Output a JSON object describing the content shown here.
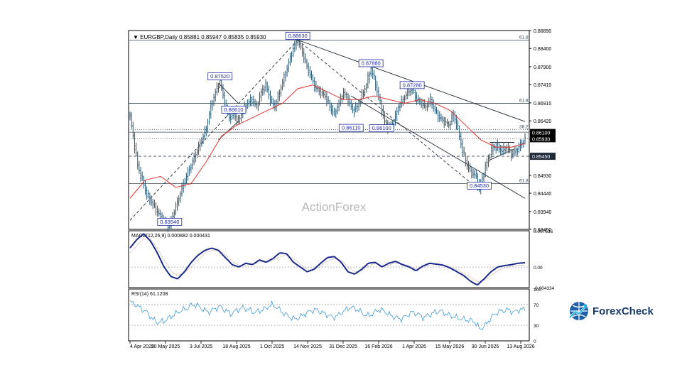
{
  "chart_data": [
    {
      "type": "candlestick",
      "header": {
        "symbol": "EURGBP,Daily",
        "values": "0.85881 0.85947 0.85835 0.85930"
      },
      "watermark": "ActionForex",
      "ylim": [
        0.8345,
        0.8889
      ],
      "y_ticks": [
        "0.88890",
        "0.88400",
        "0.87900",
        "0.87410",
        "0.86910",
        "0.86420",
        "0.85930",
        "0.85450",
        "0.84930",
        "0.84440",
        "0.83940",
        "0.83450"
      ],
      "x_ticks": [
        "4 Apr 2025",
        "20 May 2025",
        "3 Jul 2025",
        "18 Aug 2025",
        "1 Oct 2025",
        "14 Nov 2025",
        "31 Dec 2025",
        "16 Feb 2026",
        "1 Apr 2026",
        "15 May 2026",
        "30 Jun 2026",
        "13 Aug 2026"
      ],
      "price_path": [
        [
          0,
          0.8655
        ],
        [
          2,
          0.86
        ],
        [
          5,
          0.852
        ],
        [
          8,
          0.848
        ],
        [
          11,
          0.844
        ],
        [
          14,
          0.842
        ],
        [
          17,
          0.84
        ],
        [
          20,
          0.838
        ],
        [
          23,
          0.8365
        ],
        [
          26,
          0.8354
        ],
        [
          29,
          0.8395
        ],
        [
          32,
          0.843
        ],
        [
          35,
          0.847
        ],
        [
          38,
          0.85
        ],
        [
          41,
          0.853
        ],
        [
          44,
          0.856
        ],
        [
          47,
          0.859
        ],
        [
          50,
          0.862
        ],
        [
          53,
          0.868
        ],
        [
          56,
          0.872
        ],
        [
          59,
          0.8752
        ],
        [
          62,
          0.869
        ],
        [
          65,
          0.865
        ],
        [
          68,
          0.8661
        ],
        [
          71,
          0.864
        ],
        [
          74,
          0.867
        ],
        [
          77,
          0.869
        ],
        [
          80,
          0.87
        ],
        [
          83,
          0.868
        ],
        [
          86,
          0.872
        ],
        [
          89,
          0.874
        ],
        [
          92,
          0.87
        ],
        [
          95,
          0.868
        ],
        [
          98,
          0.872
        ],
        [
          101,
          0.876
        ],
        [
          104,
          0.88
        ],
        [
          107,
          0.884
        ],
        [
          110,
          0.8863
        ],
        [
          113,
          0.883
        ],
        [
          116,
          0.879
        ],
        [
          119,
          0.876
        ],
        [
          122,
          0.873
        ],
        [
          125,
          0.872
        ],
        [
          128,
          0.871
        ],
        [
          131,
          0.868
        ],
        [
          134,
          0.866
        ],
        [
          137,
          0.869
        ],
        [
          140,
          0.872
        ],
        [
          143,
          0.87
        ],
        [
          146,
          0.867
        ],
        [
          149,
          0.868
        ],
        [
          152,
          0.871
        ],
        [
          155,
          0.874
        ],
        [
          158,
          0.8788
        ],
        [
          161,
          0.874
        ],
        [
          164,
          0.869
        ],
        [
          167,
          0.864
        ],
        [
          170,
          0.862
        ],
        [
          173,
          0.864
        ],
        [
          176,
          0.868
        ],
        [
          179,
          0.87
        ],
        [
          182,
          0.872
        ],
        [
          185,
          0.8728
        ],
        [
          188,
          0.87
        ],
        [
          191,
          0.869
        ],
        [
          194,
          0.868
        ],
        [
          197,
          0.87
        ],
        [
          200,
          0.867
        ],
        [
          203,
          0.865
        ],
        [
          206,
          0.864
        ],
        [
          209,
          0.863
        ],
        [
          212,
          0.866
        ],
        [
          215,
          0.862
        ],
        [
          218,
          0.856
        ],
        [
          221,
          0.852
        ],
        [
          224,
          0.85
        ],
        [
          227,
          0.849
        ],
        [
          229,
          0.8453
        ],
        [
          232,
          0.85
        ],
        [
          235,
          0.854
        ],
        [
          238,
          0.857
        ],
        [
          241,
          0.857
        ],
        [
          244,
          0.856
        ],
        [
          247,
          0.857
        ],
        [
          250,
          0.855
        ],
        [
          253,
          0.856
        ],
        [
          256,
          0.8575
        ],
        [
          259,
          0.8593
        ]
      ],
      "ma_path": [
        [
          0,
          0.843
        ],
        [
          10,
          0.848
        ],
        [
          20,
          0.849
        ],
        [
          30,
          0.846
        ],
        [
          40,
          0.847
        ],
        [
          50,
          0.853
        ],
        [
          60,
          0.86
        ],
        [
          70,
          0.863
        ],
        [
          80,
          0.865
        ],
        [
          90,
          0.867
        ],
        [
          100,
          0.869
        ],
        [
          110,
          0.873
        ],
        [
          120,
          0.874
        ],
        [
          130,
          0.872
        ],
        [
          140,
          0.87
        ],
        [
          150,
          0.87
        ],
        [
          160,
          0.871
        ],
        [
          170,
          0.87
        ],
        [
          180,
          0.869
        ],
        [
          190,
          0.87
        ],
        [
          200,
          0.869
        ],
        [
          210,
          0.867
        ],
        [
          220,
          0.863
        ],
        [
          230,
          0.859
        ],
        [
          240,
          0.857
        ],
        [
          250,
          0.857
        ],
        [
          259,
          0.858
        ]
      ],
      "trendlines": [
        {
          "x1": 0,
          "y1": 0.837,
          "x2": 110,
          "y2": 0.8863,
          "style": "dashed"
        },
        {
          "x1": 110,
          "y1": 0.8863,
          "x2": 229,
          "y2": 0.8453,
          "style": "dashed"
        },
        {
          "x1": 110,
          "y1": 0.8863,
          "x2": 259,
          "y2": 0.864,
          "style": "solid"
        },
        {
          "x1": 145,
          "y1": 0.871,
          "x2": 259,
          "y2": 0.843,
          "style": "solid"
        },
        {
          "x1": 58,
          "y1": 0.8745,
          "x2": 71,
          "y2": 0.869,
          "style": "solid"
        },
        {
          "x1": 58,
          "y1": 0.859,
          "x2": 71,
          "y2": 0.864,
          "style": "solid"
        },
        {
          "x1": 236,
          "y1": 0.8583,
          "x2": 252,
          "y2": 0.8583,
          "style": "solid"
        },
        {
          "x1": 236,
          "y1": 0.8535,
          "x2": 252,
          "y2": 0.8565,
          "style": "solid"
        }
      ],
      "hlines": [
        {
          "y": 0.8863,
          "label": "61.8",
          "style": "solid"
        },
        {
          "y": 0.869,
          "label": "61.8",
          "style": "solid"
        },
        {
          "y": 0.8611,
          "label": "",
          "style": "solid"
        },
        {
          "y": 0.8618,
          "label": "38.2",
          "style": "dotted"
        },
        {
          "y": 0.8593,
          "label": "",
          "style": "dotted"
        },
        {
          "y": 0.8545,
          "label": "",
          "style": "dashed"
        },
        {
          "y": 0.847,
          "label": "61.8",
          "style": "solid"
        }
      ],
      "price_labels": [
        {
          "x": 110,
          "y": 0.8863,
          "text": "0.88630"
        },
        {
          "x": 158,
          "y": 0.8788,
          "text": "0.87880"
        },
        {
          "x": 59,
          "y": 0.8752,
          "text": "0.87520"
        },
        {
          "x": 185,
          "y": 0.8728,
          "text": "0.87280"
        },
        {
          "x": 68,
          "y": 0.8661,
          "text": "0.86610"
        },
        {
          "x": 145,
          "y": 0.8611,
          "text": "0.86110"
        },
        {
          "x": 165,
          "y": 0.861,
          "text": "0.86100"
        },
        {
          "x": 229,
          "y": 0.8453,
          "text": "0.84530"
        },
        {
          "x": 26,
          "y": 0.8354,
          "text": "0.83540"
        }
      ],
      "axis_badges": [
        {
          "y": 0.861,
          "text": "0.86100",
          "color": "#000000"
        },
        {
          "y": 0.8593,
          "text": "0.85930",
          "color": "#000000"
        },
        {
          "y": 0.8545,
          "text": "0.85450",
          "color": "#1f2b3a"
        }
      ]
    },
    {
      "type": "line",
      "label": "MACD(12,26,9) 0.000882 0.000431",
      "ylim": [
        -0.004334,
        0.007636
      ],
      "y_ticks": [
        "0.007636",
        "0.00",
        "-0.004334"
      ],
      "series": [
        {
          "values": [
            0.004,
            0.0058,
            0.007,
            0.0055,
            0.003,
            0.0,
            -0.002,
            -0.0025,
            -0.001,
            0.001,
            0.0025,
            0.0035,
            0.004,
            0.0035,
            0.002,
            0.0005,
            0.0,
            0.0008,
            0.0005,
            0.0015,
            0.001,
            0.0018,
            0.003,
            0.0028,
            0.001,
            0.0,
            -0.001,
            -0.0005,
            0.0008,
            0.002,
            0.0022,
            0.001,
            -0.001,
            -0.0015,
            -0.0005,
            0.0008,
            0.001,
            0.0,
            0.0008,
            0.0012,
            0.0005,
            0.0,
            -0.0008,
            0.0002,
            0.0008,
            0.0006,
            0.0004,
            -0.0002,
            -0.001,
            -0.0018,
            -0.003,
            -0.0038,
            -0.0025,
            -0.001,
            0.0,
            0.0003,
            0.0005,
            0.0008,
            0.0009
          ]
        },
        {
          "values": [
            0.003,
            0.0045,
            0.006,
            0.0058,
            0.004,
            0.0015,
            -0.0008,
            -0.0018,
            -0.0012,
            0.0,
            0.0015,
            0.0028,
            0.0035,
            0.0036,
            0.0027,
            0.0012,
            0.0004,
            0.0004,
            0.0006,
            0.001,
            0.0012,
            0.0014,
            0.0022,
            0.0025,
            0.0018,
            0.0006,
            -0.0004,
            -0.0006,
            0.0002,
            0.0012,
            0.0018,
            0.0014,
            0.0,
            -0.001,
            -0.0008,
            0.0002,
            0.0008,
            0.0004,
            0.0004,
            0.0009,
            0.0007,
            0.0002,
            -0.0004,
            -0.0001,
            0.0004,
            0.0005,
            0.0004,
            0.0,
            -0.0006,
            -0.0013,
            -0.0022,
            -0.0031,
            -0.0028,
            -0.0018,
            -0.0008,
            -0.0002,
            0.0002,
            0.0004,
            0.0004
          ]
        }
      ]
    },
    {
      "type": "line",
      "label": "RSI(14) 61.1208",
      "ylim": [
        0,
        100
      ],
      "y_ticks": [
        "100",
        "70",
        "30",
        "0"
      ],
      "series": [
        {
          "values": [
            75,
            70,
            62,
            55,
            42,
            35,
            38,
            45,
            52,
            58,
            62,
            70,
            68,
            60,
            55,
            62,
            66,
            58,
            52,
            60,
            64,
            60,
            55,
            58,
            62,
            70,
            65,
            55,
            48,
            42,
            45,
            52,
            58,
            60,
            55,
            50,
            45,
            50,
            58,
            65,
            62,
            55,
            48,
            52,
            60,
            58,
            50,
            45,
            42,
            48,
            55,
            52,
            45,
            50,
            55,
            58,
            52,
            48,
            44,
            42,
            40,
            38,
            22,
            30,
            45,
            55,
            58,
            60,
            55,
            60,
            61
          ]
        }
      ]
    }
  ],
  "logo": {
    "text": "ForexCheck"
  }
}
